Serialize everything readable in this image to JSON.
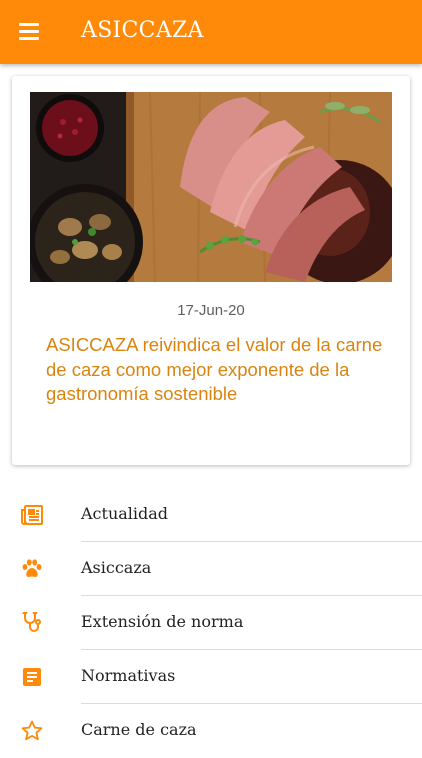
{
  "app": {
    "title": "ASICCAZA",
    "accent_color": "#ff8a0a"
  },
  "header": {
    "menu_icon": "hamburger-menu-icon"
  },
  "featured_article": {
    "date": "17-Jun-20",
    "headline": "ASICCAZA reivindica el valor de la carne de caza como mejor exponente de la gastronomía sostenible",
    "image_alt": "Carne de caza asada con hierbas, fruta roja y champiñones"
  },
  "menu": {
    "items": [
      {
        "label": "Actualidad",
        "icon": "newspaper-icon"
      },
      {
        "label": "Asiccaza",
        "icon": "paw-icon"
      },
      {
        "label": "Extensión de norma",
        "icon": "stethoscope-icon"
      },
      {
        "label": "Normativas",
        "icon": "document-icon"
      },
      {
        "label": "Carne de caza",
        "icon": "star-icon"
      }
    ]
  }
}
